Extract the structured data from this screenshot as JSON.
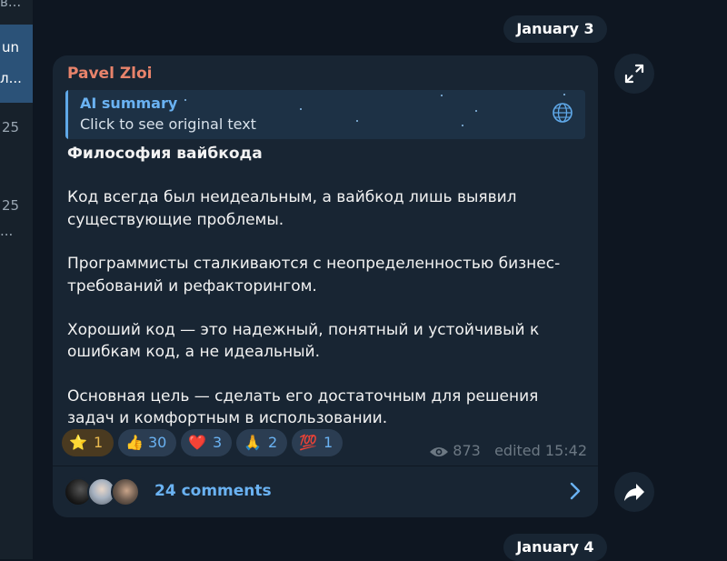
{
  "sidebar": {
    "items": [
      {
        "text": "в..."
      },
      {
        "text": "un"
      },
      {
        "text": "л..."
      },
      {
        "text": "25"
      },
      {
        "text": "25"
      },
      {
        "text": "..."
      }
    ]
  },
  "dates": {
    "top": "January 3",
    "bottom": "January 4"
  },
  "message": {
    "sender": "Pavel Zloi",
    "sender_color": "#e8836b",
    "ai_summary": {
      "title": "AI summary",
      "subtitle": "Click to see original text",
      "icon": "ai-sparkle-globe-icon"
    },
    "title": "Философия вайбкода",
    "paragraphs": [
      "Код всегда был неидеальным, а вайбкод лишь выявил существующие проблемы.",
      "Программисты сталкиваются с неопределенностью бизнес-требований и рефакторингом.",
      "Хороший код — это надежный, понятный и устойчивый к ошибкам код, а не идеальный.",
      "Основная цель — сделать его достаточным для решения задач и комфортным в использовании."
    ],
    "reactions": [
      {
        "emoji": "⭐",
        "count": "1",
        "own": true
      },
      {
        "emoji": "👍",
        "count": "30",
        "own": false
      },
      {
        "emoji": "❤️",
        "count": "3",
        "own": false
      },
      {
        "emoji": "🙏",
        "count": "2",
        "own": false
      },
      {
        "emoji": "💯",
        "count": "1",
        "own": false
      }
    ],
    "views": "873",
    "edited": "edited 15:42",
    "comments": "24 comments"
  },
  "buttons": {
    "expand_icon": "expand-icon",
    "share_icon": "share-arrow-icon"
  },
  "colors": {
    "background": "#0e1621",
    "bubble": "#182533",
    "accent": "#6ab2f2"
  }
}
